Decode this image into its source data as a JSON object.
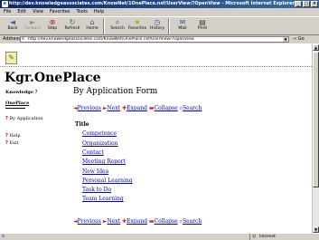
{
  "window": {
    "title": "http://dev.knowledgeassociates.com/KnowNet/1OnePlace.nsf/UserView/?OpenView - Microsoft Internet Explorer"
  },
  "menu": [
    "File",
    "Edit",
    "View",
    "Favorites",
    "Tools",
    "Help"
  ],
  "toolbar": {
    "back": "Back",
    "forward": "Forward",
    "stop": "Stop",
    "refresh": "Refresh",
    "home": "Home",
    "search": "Search",
    "favorites": "Favorites",
    "history": "History",
    "mail": "Mail",
    "print": "Print"
  },
  "address": {
    "label": "Address",
    "url": "http://dev.knowledgeassociates.com/KnowNet/OnePlace.nsf/UserView/?OpenView",
    "go": "Go"
  },
  "page": {
    "site_title": "Kgr.OnePlace",
    "sidebar": {
      "heading": "Knowledge",
      "oneplace": "OnePlace",
      "by_application": "By Application",
      "help": "Help",
      "exit": "Exit"
    },
    "form_title": "By Application Form",
    "nav": {
      "previous": "Previous",
      "next": "Next",
      "expand": "Expand",
      "collapse": "Collapse",
      "search": "Search"
    },
    "column_title": "Title",
    "items": [
      "Competence",
      "Organization",
      "Contact",
      "Meeting Report",
      "New Idea",
      "Personal Learning",
      "Task to Do",
      "Team Learning"
    ]
  },
  "status": {
    "zone": "Internet"
  }
}
